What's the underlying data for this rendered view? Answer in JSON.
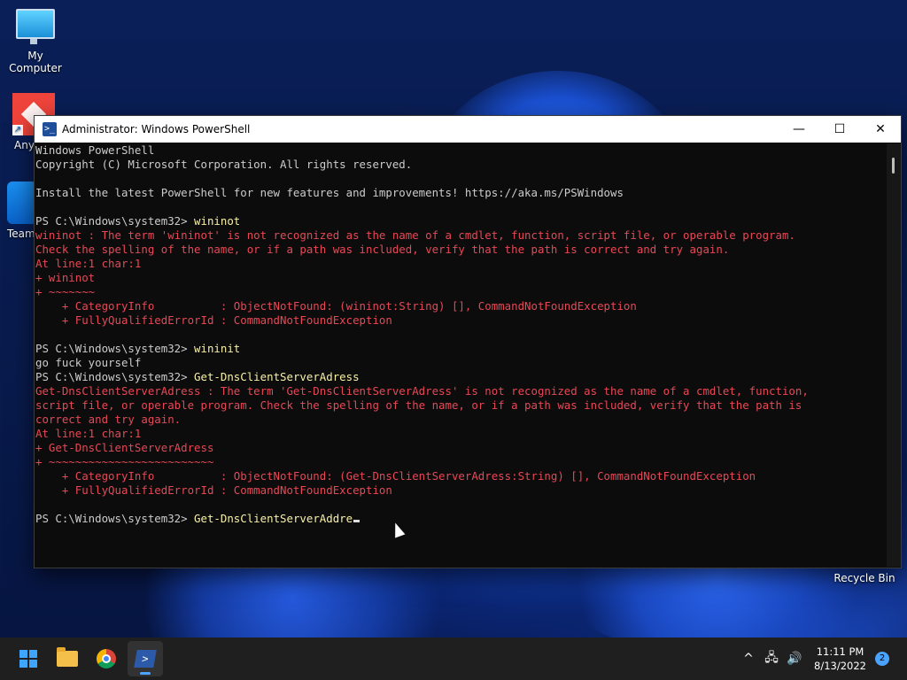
{
  "desktop": {
    "icons": [
      {
        "label": "My Computer"
      },
      {
        "label": "Any"
      },
      {
        "label": "TeamV"
      }
    ],
    "recycle_bin": "Recycle Bin"
  },
  "window": {
    "title": "Administrator: Windows PowerShell",
    "controls": {
      "minimize": "—",
      "maximize": "☐",
      "close": "✕"
    }
  },
  "console": {
    "lines": [
      {
        "text": "Windows PowerShell",
        "style": "out"
      },
      {
        "text": "Copyright (C) Microsoft Corporation. All rights reserved.",
        "style": "out"
      },
      {
        "text": "",
        "style": "out"
      },
      {
        "text": "Install the latest PowerShell for new features and improvements! https://aka.ms/PSWindows",
        "style": "out"
      },
      {
        "text": "",
        "style": "out"
      },
      {
        "prompt": "PS C:\\Windows\\system32> ",
        "cmd": "wininot",
        "style": "prompt"
      },
      {
        "text": "wininot : The term 'wininot' is not recognized as the name of a cmdlet, function, script file, or operable program.",
        "style": "err"
      },
      {
        "text": "Check the spelling of the name, or if a path was included, verify that the path is correct and try again.",
        "style": "err"
      },
      {
        "text": "At line:1 char:1",
        "style": "err"
      },
      {
        "text": "+ wininot",
        "style": "err"
      },
      {
        "text": "+ ~~~~~~~",
        "style": "err"
      },
      {
        "text": "    + CategoryInfo          : ObjectNotFound: (wininot:String) [], CommandNotFoundException",
        "style": "err"
      },
      {
        "text": "    + FullyQualifiedErrorId : CommandNotFoundException",
        "style": "err"
      },
      {
        "text": "",
        "style": "out"
      },
      {
        "prompt": "PS C:\\Windows\\system32> ",
        "cmd": "wininit",
        "style": "prompt"
      },
      {
        "text": "go fuck yourself",
        "style": "out"
      },
      {
        "prompt": "PS C:\\Windows\\system32> ",
        "cmd": "Get-DnsClientServerAdress",
        "style": "prompt"
      },
      {
        "text": "Get-DnsClientServerAdress : The term 'Get-DnsClientServerAdress' is not recognized as the name of a cmdlet, function,",
        "style": "err"
      },
      {
        "text": "script file, or operable program. Check the spelling of the name, or if a path was included, verify that the path is",
        "style": "err"
      },
      {
        "text": "correct and try again.",
        "style": "err"
      },
      {
        "text": "At line:1 char:1",
        "style": "err"
      },
      {
        "text": "+ Get-DnsClientServerAdress",
        "style": "err"
      },
      {
        "text": "+ ~~~~~~~~~~~~~~~~~~~~~~~~~",
        "style": "err"
      },
      {
        "text": "    + CategoryInfo          : ObjectNotFound: (Get-DnsClientServerAdress:String) [], CommandNotFoundException",
        "style": "err"
      },
      {
        "text": "    + FullyQualifiedErrorId : CommandNotFoundException",
        "style": "err"
      },
      {
        "text": "",
        "style": "out"
      },
      {
        "prompt": "PS C:\\Windows\\system32> ",
        "cmd": "Get-DnsClientServerAddre",
        "style": "prompt",
        "cursor": true
      }
    ]
  },
  "taskbar": {
    "apps": [
      {
        "name": "start",
        "icon": "windows-logo-icon"
      },
      {
        "name": "file-explorer",
        "icon": "folder-icon"
      },
      {
        "name": "chrome",
        "icon": "chrome-icon"
      },
      {
        "name": "powershell",
        "icon": "powershell-icon",
        "active": true
      }
    ],
    "tray": {
      "chevron": "^",
      "network": "🖧",
      "volume": "🔊",
      "time": "11:11 PM",
      "date": "8/13/2022",
      "notifications": "2"
    }
  },
  "colors": {
    "console_bg": "#0c0c0c",
    "console_text": "#cccccc",
    "error_text": "#e74856",
    "command_text": "#f9f1a5",
    "accent": "#4ca3ff"
  }
}
